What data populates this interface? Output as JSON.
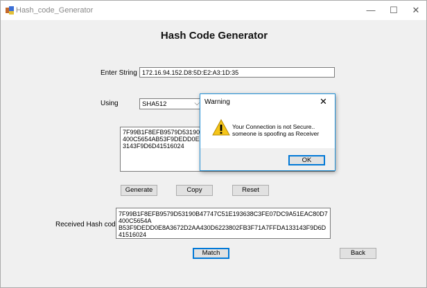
{
  "window": {
    "title": "Hash_code_Generator",
    "minimize_glyph": "—",
    "maximize_glyph": "☐",
    "close_glyph": "✕"
  },
  "form": {
    "heading": "Hash Code Generator",
    "enter_string_label": "Enter String",
    "enter_string_value": "172.16.94.152.D8:5D:E2:A3:1D:35",
    "using_label": "Using",
    "using_value": "SHA512",
    "hash_output_value": "7F99B1F8EFB9579D53190B47747C51E193638C3FE07DC9A51EAC80D7400C5654AB53F9DEDD0E8A3672D2AA430D6223802FB3F71A7FFDA133143F9D6D41516024",
    "generate_label": "Generate",
    "copy_label": "Copy",
    "reset_label": "Reset",
    "received_label": "Received Hash code",
    "received_value": "7F99B1F8EFB9579D53190B47747C51E193638C3FE07DC9A51EAC80D7400C5654A\nB53F9DEDD0E8A3672D2AA430D6223802FB3F71A7FFDA133143F9D6D41516024",
    "match_label": "Match",
    "back_label": "Back"
  },
  "dialog": {
    "title": "Warning",
    "close_glyph": "✕",
    "message_line1": "Your Connection is not Secure..",
    "message_line2": "someone is spoofing as Receiver",
    "ok_label": "OK",
    "icon": "warning-icon"
  },
  "colors": {
    "accent": "#0078d7",
    "warning": "#f5c518"
  }
}
